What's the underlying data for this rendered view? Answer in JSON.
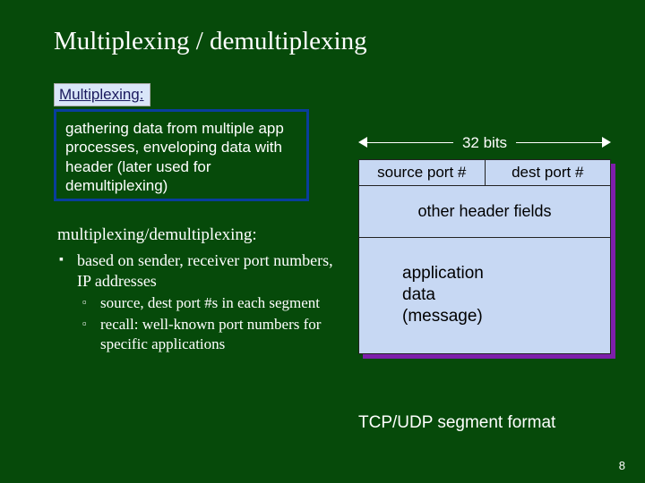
{
  "title": "Multiplexing / demultiplexing",
  "mux_label": "Multiplexing:",
  "definition": "gathering data from multiple  app processes, enveloping data with header (later used for demultiplexing)",
  "subheading": "multiplexing/demultiplexing:",
  "bullets": {
    "b1": "based on sender, receiver port numbers, IP addresses",
    "b1a": "source, dest port #s in each segment",
    "b1b": "recall: well-known port numbers for specific applications"
  },
  "diagram": {
    "bits_label": "32 bits",
    "source_port": "source port #",
    "dest_port": "dest port #",
    "other_fields": "other header fields",
    "app_data": "application\ndata\n(message)",
    "caption": "TCP/UDP segment format"
  },
  "page_number": "8"
}
